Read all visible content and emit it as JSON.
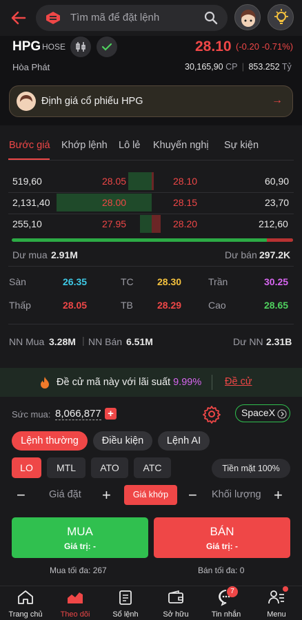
{
  "search": {
    "placeholder": "Tìm mã để đặt lệnh"
  },
  "stock": {
    "ticker": "HPG",
    "exchange": "HOSE",
    "company": "Hòa Phát",
    "price": "28.10",
    "change": "(-0.20 -0.71%)",
    "volume_line": "30,165,90",
    "cp_label": "CP",
    "value_line": "853.252",
    "value_unit": "Tỷ"
  },
  "banner": {
    "text": "Định giá cổ phiếu HPG",
    "arrow": "→"
  },
  "tabs": [
    "Bước giá",
    "Khớp lệnh",
    "Lô lẻ",
    "Khuyến nghị",
    "Sự kiện"
  ],
  "orderbook": {
    "rows": [
      {
        "bid_vol": "519,60",
        "bid_price": "28.05",
        "ask_price": "28.10",
        "ask_vol": "60,90"
      },
      {
        "bid_vol": "2,131,40",
        "bid_price": "28.00",
        "ask_price": "28.15",
        "ask_vol": "23,70"
      },
      {
        "bid_vol": "255,10",
        "bid_price": "27.95",
        "ask_price": "28.20",
        "ask_vol": "212,60"
      }
    ],
    "buy_ratio": 0.907,
    "du_mua_label": "Dư mua",
    "du_mua": "2.91M",
    "du_ban_label": "Dư bán",
    "du_ban": "297.2K"
  },
  "stats": {
    "san_label": "Sàn",
    "san": "26.35",
    "tc_label": "TC",
    "tc": "28.30",
    "tran_label": "Trần",
    "tran": "30.25",
    "thap_label": "Thấp",
    "thap": "28.05",
    "tb_label": "TB",
    "tb": "28.29",
    "cao_label": "Cao",
    "cao": "28.65"
  },
  "foreign": {
    "nn_mua_label": "NN Mua",
    "nn_mua": "3.28M",
    "nn_ban_label": "NN Bán",
    "nn_ban": "6.51M",
    "du_nn_label": "Dư NN",
    "du_nn": "2.31B"
  },
  "promo": {
    "text": "Đề cử mã này với lãi suất ",
    "rate": "9.99%",
    "link": "Đề cử"
  },
  "order": {
    "suc_mua_label": "Sức mua:",
    "suc_mua": "8,066,877",
    "account": "SpaceX",
    "order_types": [
      "Lệnh thường",
      "Điều kiện",
      "Lệnh AI"
    ],
    "price_types": [
      "LO",
      "MTL",
      "ATO",
      "ATC"
    ],
    "cash_label": "Tiền mặt 100%",
    "price_placeholder": "Giá đặt",
    "match_button": "Giá khớp",
    "qty_placeholder": "Khối lượng",
    "buy_label": "MUA",
    "buy_value": "Giá trị: -",
    "sell_label": "BÁN",
    "sell_value": "Giá trị: -",
    "max_buy": "Mua tối đa: 267",
    "max_sell": "Bán tối đa: 0"
  },
  "nav": {
    "items": [
      "Trang chủ",
      "Theo dõi",
      "Sổ lệnh",
      "Sở hữu",
      "Tin nhắn",
      "Menu"
    ],
    "message_badge": "7"
  },
  "colors": {
    "accent": "#ef4747",
    "up": "#4fd15e",
    "ref": "#f5c23e",
    "floor": "#3ec9e6",
    "ceiling": "#d766f0"
  }
}
